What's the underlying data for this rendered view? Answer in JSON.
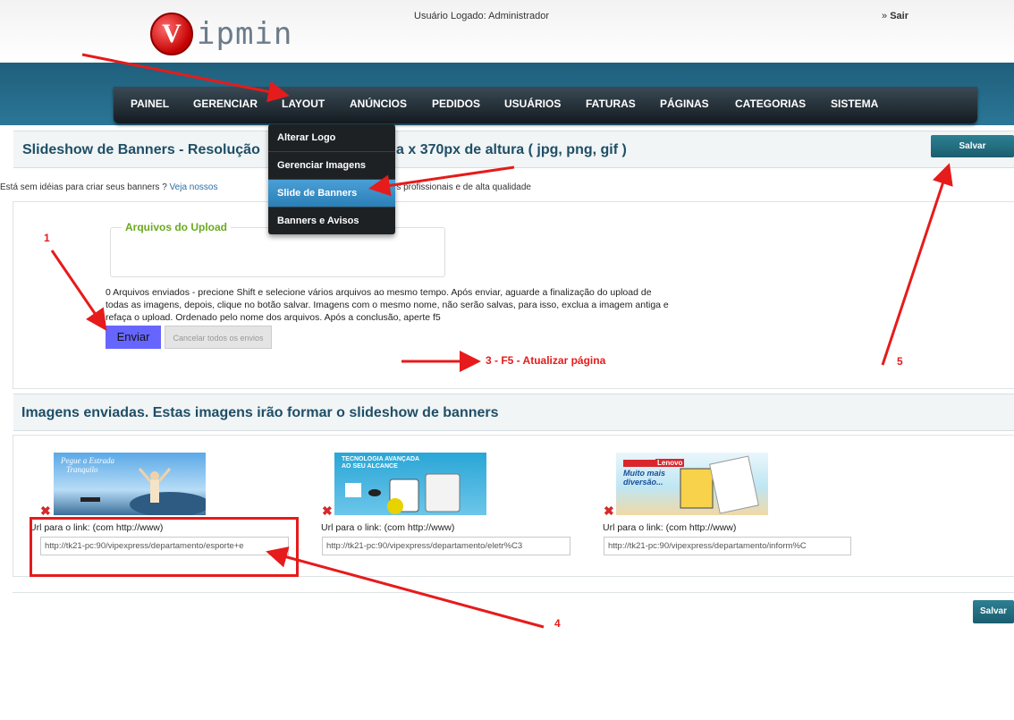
{
  "header": {
    "logo_letter": "V",
    "logo_text": "ipmin",
    "user_label": "Usuário Logado: Administrador",
    "logout_prefix": "»",
    "logout_label": "Sair"
  },
  "nav": {
    "items": [
      "PAINEL",
      "GERENCIAR",
      "LAYOUT",
      "ANÚNCIOS",
      "PEDIDOS",
      "USUÁRIOS",
      "FATURAS",
      "PÁGINAS",
      "CATEGORIAS",
      "SISTEMA"
    ],
    "dropdown": [
      "Alterar Logo",
      "Gerenciar Imagens",
      "Slide de Banners",
      "Banners e Avisos"
    ]
  },
  "slideshow": {
    "title": "Slideshow de Banners - Resolução",
    "title_rest": "a x 370px de altura ( jpg, png, gif )",
    "save_label": "Salvar"
  },
  "hint": {
    "text": "Está sem idéias para criar seus banners ?",
    "link": "Veja nossos",
    "rest": "rs profissionais e de alta qualidade"
  },
  "upload": {
    "legend": "Arquivos do Upload",
    "info": "0 Arquivos enviados - precione Shift e selecione vários arquivos ao mesmo tempo. Após enviar, aguarde a finalização do upload de todas as imagens, depois, clique no botão salvar. Imagens com o mesmo nome, não serão salvas, para isso, exclua a imagem antiga e refaça o upload. Ordenado pelo nome dos arquivos. Após a conclusão, aperte f5",
    "send_label": "Enviar",
    "cancel_label": "Cancelar todos os envios"
  },
  "annotations": {
    "n1": "1",
    "n3": "3 - F5  - Atualizar página",
    "n4": "4",
    "n5": "5"
  },
  "images": {
    "title": "Imagens enviadas. Estas imagens irão formar o slideshow de banners",
    "url_label": "Url para o link: (com http://www)",
    "banner1_lines": [
      "Pegue a Estrada",
      "Tranquilo"
    ],
    "banner2_lines": [
      "TECNOLOGIA AVANÇADA",
      "AO SEU ALCANCE"
    ],
    "banner3_lines": [
      "Lenovo",
      "Muito mais",
      "diversão..."
    ],
    "items": [
      {
        "url": "http://tk21-pc:90/vipexpress/departamento/esporte+e"
      },
      {
        "url": "http://tk21-pc:90/vipexpress/departamento/eletr%C3"
      },
      {
        "url": "http://tk21-pc:90/vipexpress/departamento/inform%C"
      }
    ],
    "save_label": "Salvar"
  },
  "colors": {
    "accent": "#2c8092",
    "nav_band": "#2b7696",
    "annotation": "#e61b1b",
    "legend": "#6aaa1e"
  }
}
